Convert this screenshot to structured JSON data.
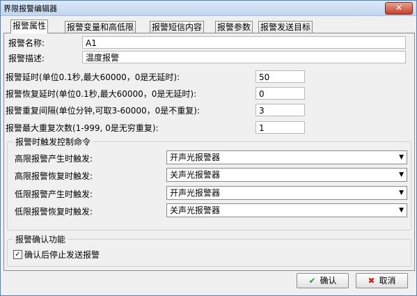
{
  "window": {
    "title": "界限报警编辑器",
    "close_label": "✕"
  },
  "tabs": [
    "报警属性",
    "报警变量和高低限",
    "报警短信内容",
    "报警参数",
    "报警发送目标"
  ],
  "fields": {
    "name_label": "报警名称:",
    "name_value": "A1",
    "desc_label": "报警描述:",
    "desc_value": "温度报警",
    "delay_label": "报警延时(单位0.1秒,最大60000，0是无延时):",
    "delay_value": "50",
    "recover_delay_label": "报警恢复延时(单位0.1秒,最大60000，0是无延时):",
    "recover_delay_value": "0",
    "repeat_interval_label": "报警重复间隔(单位分钟,可取3-60000，0是不重复):",
    "repeat_interval_value": "3",
    "max_repeat_label": "报警最大重复次数(1-999, 0是无穷重复):",
    "max_repeat_value": "1"
  },
  "trigger_group": {
    "title": "报警时触发控制命令",
    "rows": [
      {
        "label": "高限报警产生时触发:",
        "value": "开声光报警器"
      },
      {
        "label": "高限报警恢复时触发:",
        "value": "关声光报警器"
      },
      {
        "label": "低限报警产生时触发:",
        "value": "开声光报警器"
      },
      {
        "label": "低限报警恢复时触发:",
        "value": "关声光报警器"
      }
    ]
  },
  "confirm_group": {
    "title": "报警确认功能",
    "checkbox_label": "确认后停止发送报警",
    "checked": true
  },
  "buttons": {
    "ok": "确认",
    "cancel": "取消"
  }
}
